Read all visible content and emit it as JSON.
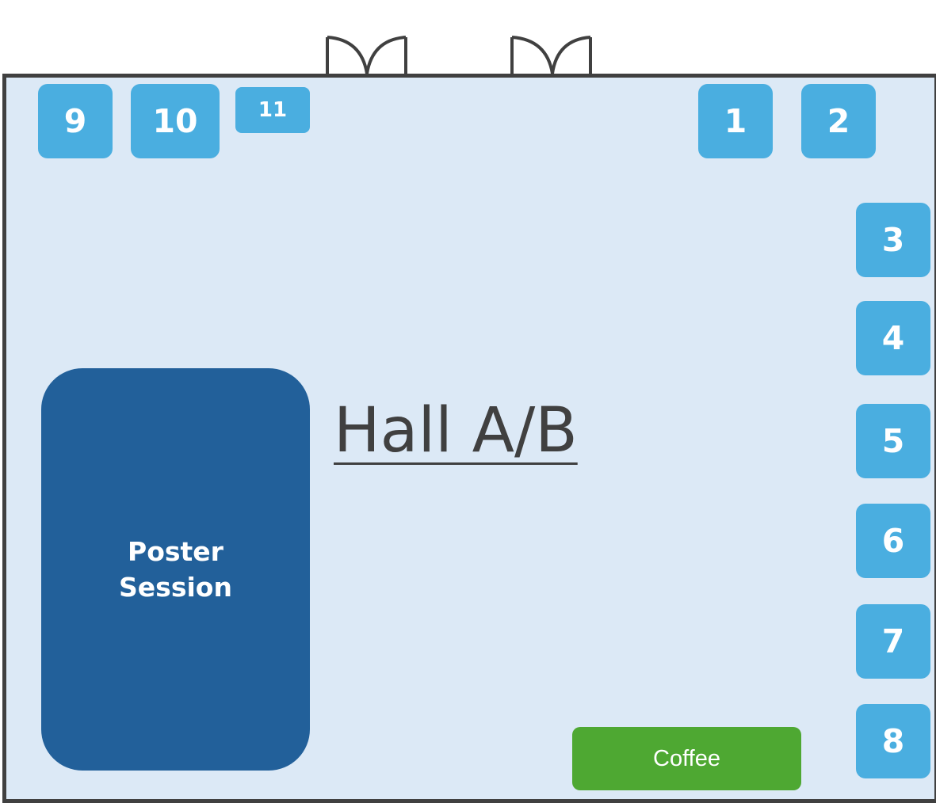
{
  "hall": {
    "title": "Hall A/B"
  },
  "booths": [
    {
      "id": "1",
      "label": "1"
    },
    {
      "id": "2",
      "label": "2"
    },
    {
      "id": "3",
      "label": "3"
    },
    {
      "id": "4",
      "label": "4"
    },
    {
      "id": "5",
      "label": "5"
    },
    {
      "id": "6",
      "label": "6"
    },
    {
      "id": "7",
      "label": "7"
    },
    {
      "id": "8",
      "label": "8"
    },
    {
      "id": "9",
      "label": "9"
    },
    {
      "id": "10",
      "label": "10"
    },
    {
      "id": "11",
      "label": "11"
    }
  ],
  "poster_session": {
    "line1": "Poster",
    "line2": "Session"
  },
  "coffee": {
    "label": "Coffee"
  },
  "colors": {
    "hall_fill": "#dce9f6",
    "hall_border": "#404040",
    "booth": "#4aaee0",
    "poster": "#22609a",
    "coffee": "#4ea832",
    "text_dark": "#404040"
  },
  "icons": [
    "door-icon",
    "door-icon"
  ]
}
